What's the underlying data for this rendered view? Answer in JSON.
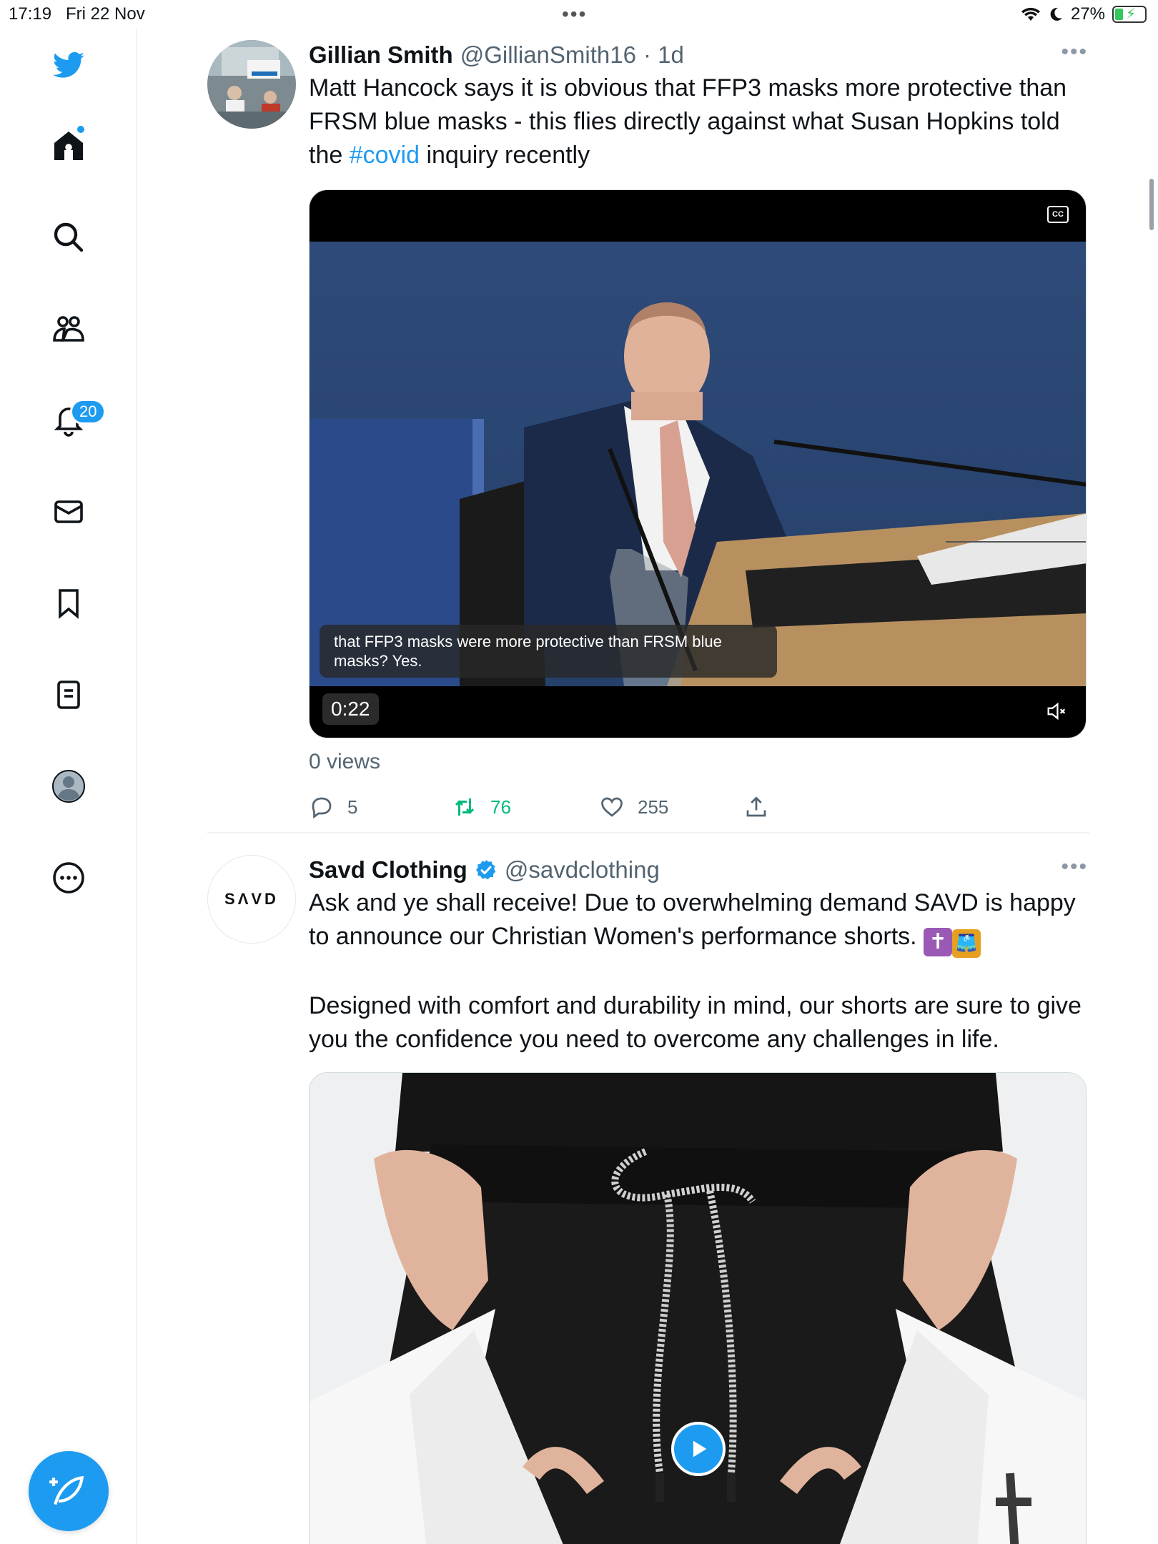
{
  "status_bar": {
    "time": "17:19",
    "date": "Fri 22 Nov",
    "dots": "•••",
    "battery_percent": "27%",
    "battery_level": 0.27
  },
  "sidebar": {
    "items": [
      {
        "name": "twitter-logo-icon"
      },
      {
        "name": "home-icon"
      },
      {
        "name": "search-icon"
      },
      {
        "name": "communities-icon"
      },
      {
        "name": "notifications-icon",
        "badge": "20"
      },
      {
        "name": "messages-icon"
      },
      {
        "name": "bookmarks-icon"
      },
      {
        "name": "lists-icon"
      },
      {
        "name": "profile-icon"
      },
      {
        "name": "more-icon"
      }
    ],
    "notification_badge": "20",
    "compose_icon": "compose-icon"
  },
  "tweets": [
    {
      "name": "Gillian Smith",
      "handle": "@GillianSmith16",
      "time": "· 1d",
      "more": "•••",
      "text_before": "Matt Hancock says it is obvious that FFP3 masks more protective than FRSM blue masks - this flies directly against what Susan Hopkins told the ",
      "hashtag": "#covid",
      "text_after": " inquiry recently",
      "video": {
        "caption": "that FFP3 masks were more protective than FRSM blue masks? Yes.",
        "duration": "0:22",
        "cc_label": "CC"
      },
      "views": "0 views",
      "replies": "5",
      "retweets": "76",
      "likes": "255",
      "colors": {
        "retweet": "#00ba7c",
        "hashtag": "#1d9bf0"
      }
    },
    {
      "name": "Savd Clothing",
      "handle": "@savdclothing",
      "more": "•••",
      "avatar_text": "SΛVD",
      "text_line1": "Ask and ye shall receive! Due to overwhelming demand SAVD is happy to announce our Christian Women's performance shorts.",
      "emojis": [
        "✝",
        "🩳"
      ],
      "text_para2": "Designed with comfort and durability in mind, our shorts are sure to give you the confidence you need to overcome any challenges in life."
    }
  ],
  "accent_color": "#1d9bf0"
}
